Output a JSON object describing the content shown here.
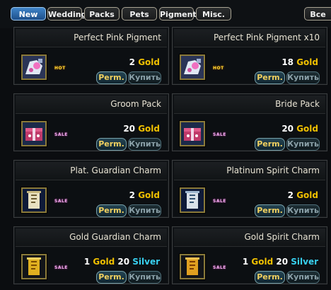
{
  "tabs": [
    {
      "label": "New",
      "active": true
    },
    {
      "label": "Wedding",
      "active": false
    },
    {
      "label": "Packs",
      "active": false
    },
    {
      "label": "Pets",
      "active": false
    },
    {
      "label": "Pigment",
      "active": false
    },
    {
      "label": "Misc.",
      "active": false
    },
    {
      "label": "Все",
      "active": false
    }
  ],
  "colors": {
    "gold": "#f0c000",
    "silver": "#38d0f0",
    "perm_text": "#f0d060",
    "tab_active": "#2f6fb0"
  },
  "labels": {
    "perm": "Perm.",
    "buy": "Купить",
    "gold": "Gold",
    "silver": "Silver"
  },
  "items": [
    {
      "name": "Perfect Pink Pigment",
      "gold": "2",
      "silver": null,
      "tag": "HOT",
      "icon": "pink-pigment-icon"
    },
    {
      "name": "Perfect Pink Pigment x10",
      "gold": "18",
      "silver": null,
      "tag": "HOT",
      "icon": "pink-pigment-icon"
    },
    {
      "name": "Groom Pack",
      "gold": "20",
      "silver": null,
      "tag": "SALE",
      "icon": "gift-box-icon"
    },
    {
      "name": "Bride Pack",
      "gold": "20",
      "silver": null,
      "tag": "SALE",
      "icon": "gift-box-icon"
    },
    {
      "name": "Plat. Guardian Charm",
      "gold": "2",
      "silver": null,
      "tag": "SALE",
      "icon": "scroll-charm-icon"
    },
    {
      "name": "Platinum Spirit Charm",
      "gold": "2",
      "silver": null,
      "tag": "SALE",
      "icon": "scroll-charm-icon"
    },
    {
      "name": "Gold Guardian Charm",
      "gold": "1",
      "silver": "20",
      "tag": "SALE",
      "icon": "gold-charm-icon"
    },
    {
      "name": "Gold Spirit Charm",
      "gold": "1",
      "silver": "20",
      "tag": "SALE",
      "icon": "gold-charm-icon"
    }
  ]
}
